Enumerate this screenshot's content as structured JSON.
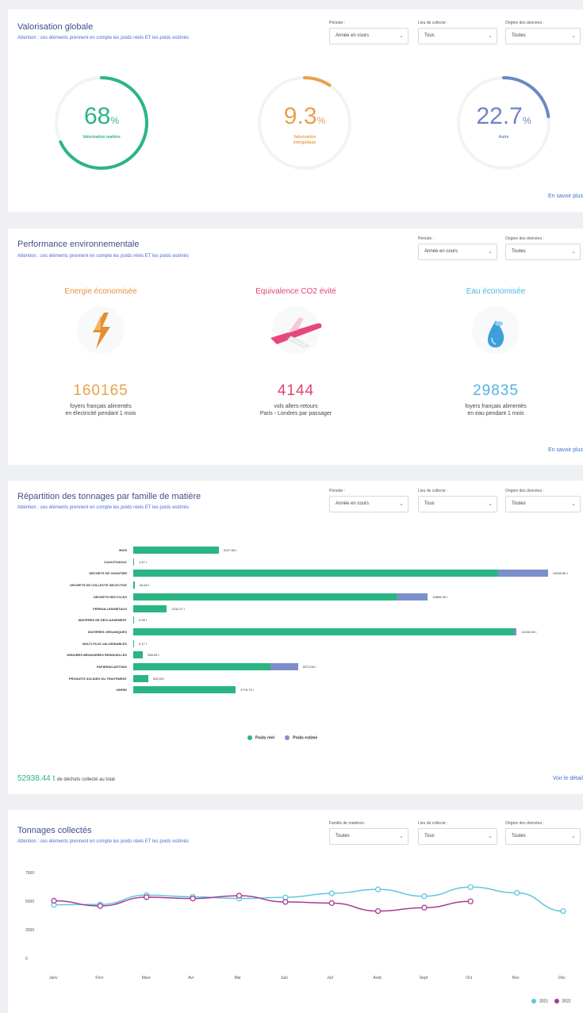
{
  "valorisation": {
    "title": "Valorisation globale",
    "subtitle": "Attention : ces éléments prennent en compte les poids réels ET les poids estimés",
    "filters": [
      {
        "label": "Période :",
        "value": "Année en cours"
      },
      {
        "label": "Lieu de collecte :",
        "value": "Tous"
      },
      {
        "label": "Origine des données :",
        "value": "Toutes"
      }
    ],
    "gauges": [
      {
        "value": "68",
        "unit": "%",
        "label": "Valorisation matière",
        "fraction": 0.68,
        "color": "#2bb583"
      },
      {
        "value": "9.3",
        "unit": "%",
        "label": "Valorisation énergétique",
        "fraction": 0.093,
        "color": "#e9a14b"
      },
      {
        "value": "22.7",
        "unit": "%",
        "label": "Autre",
        "fraction": 0.227,
        "color": "#6c86c6"
      }
    ],
    "more_link": "En savoir plus"
  },
  "performance": {
    "title": "Performance environnementale",
    "subtitle": "Attention : ces éléments prennent en compte les poids réels ET les poids estimés",
    "filters": [
      {
        "label": "Période :",
        "value": "Année en cours"
      },
      {
        "label": "Origine des données :",
        "value": "Toutes"
      }
    ],
    "items": [
      {
        "title": "Energie économisée",
        "value": "160165",
        "desc1": "foyers français alimentés",
        "desc2": "en électricité pendant 1 mois",
        "color": "#e9923d",
        "icon": "lightning-icon"
      },
      {
        "title": "Equivalence CO2 évité",
        "value": "4144",
        "desc1": "vols allers-retours",
        "desc2": "Paris - Londres par passager",
        "color": "#e0456b",
        "icon": "airplane-icon"
      },
      {
        "title": "Eau économisée",
        "value": "29835",
        "desc1": "foyers français alimentés",
        "desc2": "en eau pendant 1 mois",
        "color": "#4fb4e4",
        "icon": "water-drop-icon"
      }
    ],
    "more_link": "En savoir plus"
  },
  "repartition": {
    "title": "Répartition des tonnages par famille de matière",
    "subtitle": "Attention : ces éléments prennent en compte les poids réels ET les poids estimés",
    "filters": [
      {
        "label": "Période :",
        "value": "Année en cours"
      },
      {
        "label": "Lieu de collecte :",
        "value": "Tous"
      },
      {
        "label": "Origine des données :",
        "value": "Toutes"
      }
    ],
    "legend": {
      "real": "Poids réel",
      "estimated": "Poids estimé"
    },
    "total_value": "52938.44 t",
    "total_text": "de déchets collecté au total",
    "detail_link": "Voir le détail"
  },
  "tonnages": {
    "title": "Tonnages collectés",
    "subtitle": "Attention : ces éléments prennent en compte les poids réels ET les poids estimés",
    "filters": [
      {
        "label": "Famille de matières :",
        "value": "Toutes"
      },
      {
        "label": "Lieu de collecte :",
        "value": "Tous"
      },
      {
        "label": "Origine des données :",
        "value": "Toutes"
      }
    ],
    "legend": [
      "2021",
      "2022"
    ]
  },
  "chart_data": [
    {
      "type": "bar",
      "orientation": "horizontal",
      "stacked": true,
      "categories": [
        "BOIS",
        "CAOUTCHOUC",
        "DECHETS DE CHANTIER",
        "DECHETS DE COLLECTE SELECTIVE",
        "DECHETS RECYCLES",
        "FERRAILLES/METAUX",
        "MATIERES DE DECLASSEMENT",
        "MATIERES ORGANIQUES",
        "MULTI-FLUX VALORISABLES",
        "ORDURES MENAGERES RESIDUELLES",
        "PAPIERS/CARTONS",
        "PRODUITS SOLIDES DU TRAITEMENT",
        "VERRE"
      ],
      "labels": [
        "3147.65 t",
        "1.47 t",
        "15286.50 t",
        "54.65 t",
        "10856.90 t",
        "1230.47 t",
        "0.28 t",
        "14138.94 t",
        "0.17 t",
        "356.05 t",
        "6073.05 t",
        "549.05 t",
        "3776.75 t"
      ],
      "series": [
        {
          "name": "Poids réel",
          "color": "#2bb583",
          "values": [
            3147.65,
            1.47,
            13450,
            54.65,
            9720,
            1230.47,
            0.28,
            14050,
            0.17,
            356.05,
            5070,
            549.05,
            3776.75
          ]
        },
        {
          "name": "Poids estimé",
          "color": "#7c8fcc",
          "values": [
            0,
            0,
            1836.5,
            0,
            1136.9,
            0,
            0,
            88.94,
            0,
            0,
            1003.05,
            0,
            0
          ]
        }
      ],
      "xlim": [
        0,
        15500
      ]
    },
    {
      "type": "line",
      "categories": [
        "Janv",
        "Févr",
        "Mars",
        "Avr",
        "Mai",
        "Juin",
        "Juil",
        "Août",
        "Sept",
        "Oct",
        "Nov",
        "Déc"
      ],
      "yticks": [
        "7500",
        "5000",
        "2500",
        "0"
      ],
      "ylim": [
        0,
        7500
      ],
      "series": [
        {
          "name": "2021",
          "color": "#5ec7e0",
          "values": [
            4750,
            4780,
            5600,
            5450,
            5300,
            5400,
            5750,
            6100,
            5500,
            6300,
            5800,
            4200
          ]
        },
        {
          "name": "2022",
          "color": "#a53c94",
          "values": [
            5100,
            4650,
            5420,
            5300,
            5550,
            5000,
            4900,
            4200,
            4500,
            5050
          ]
        }
      ]
    }
  ]
}
